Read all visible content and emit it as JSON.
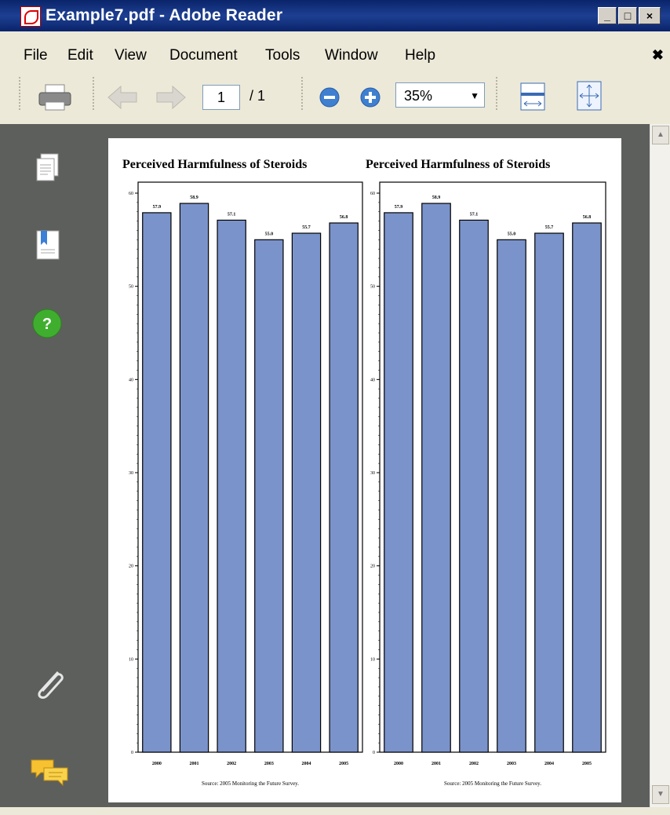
{
  "window": {
    "title": "Example7.pdf - Adobe Reader",
    "min_label": "_",
    "max_label": "□",
    "close_label": "×"
  },
  "menu": {
    "items": [
      "File",
      "Edit",
      "View",
      "Document",
      "Tools",
      "Window",
      "Help"
    ],
    "close_doc": "✖"
  },
  "toolbar": {
    "page_current": "1",
    "page_total": "/ 1",
    "zoom": "35%"
  },
  "icons": {
    "print": "print-icon",
    "prev": "previous-page-icon",
    "next": "next-page-icon",
    "zoom_out": "zoom-out-icon",
    "zoom_in": "zoom-in-icon",
    "fit_width": "fit-width-icon",
    "fit_page": "fit-page-icon",
    "pages": "pages-icon",
    "bookmarks": "bookmarks-icon",
    "help": "help-icon",
    "attachments": "paperclip-icon",
    "comments": "comments-icon"
  },
  "chart_data": [
    {
      "type": "bar",
      "title": "Perceived Harmfulness of Steroids",
      "categories": [
        "2000",
        "2001",
        "2002",
        "2003",
        "2004",
        "2005"
      ],
      "values": [
        57.9,
        58.9,
        57.1,
        55.0,
        55.7,
        56.8
      ],
      "ylim": [
        0,
        60
      ],
      "yticks": [
        "0",
        "10",
        "20",
        "30",
        "40",
        "50",
        "60"
      ],
      "bar_color": "#7b93cb",
      "source": "Source: 2005 Monitoring the Future Survey."
    },
    {
      "type": "bar",
      "title": "Perceived Harmfulness of Steroids",
      "categories": [
        "2000",
        "2001",
        "2002",
        "2003",
        "2004",
        "2005"
      ],
      "values": [
        57.9,
        58.9,
        57.1,
        55.0,
        55.7,
        56.8
      ],
      "ylim": [
        0,
        60
      ],
      "yticks": [
        "0",
        "10",
        "20",
        "30",
        "40",
        "50",
        "60"
      ],
      "bar_color": "#7b93cb",
      "source": "Source: 2005 Monitoring the Future Survey."
    }
  ]
}
